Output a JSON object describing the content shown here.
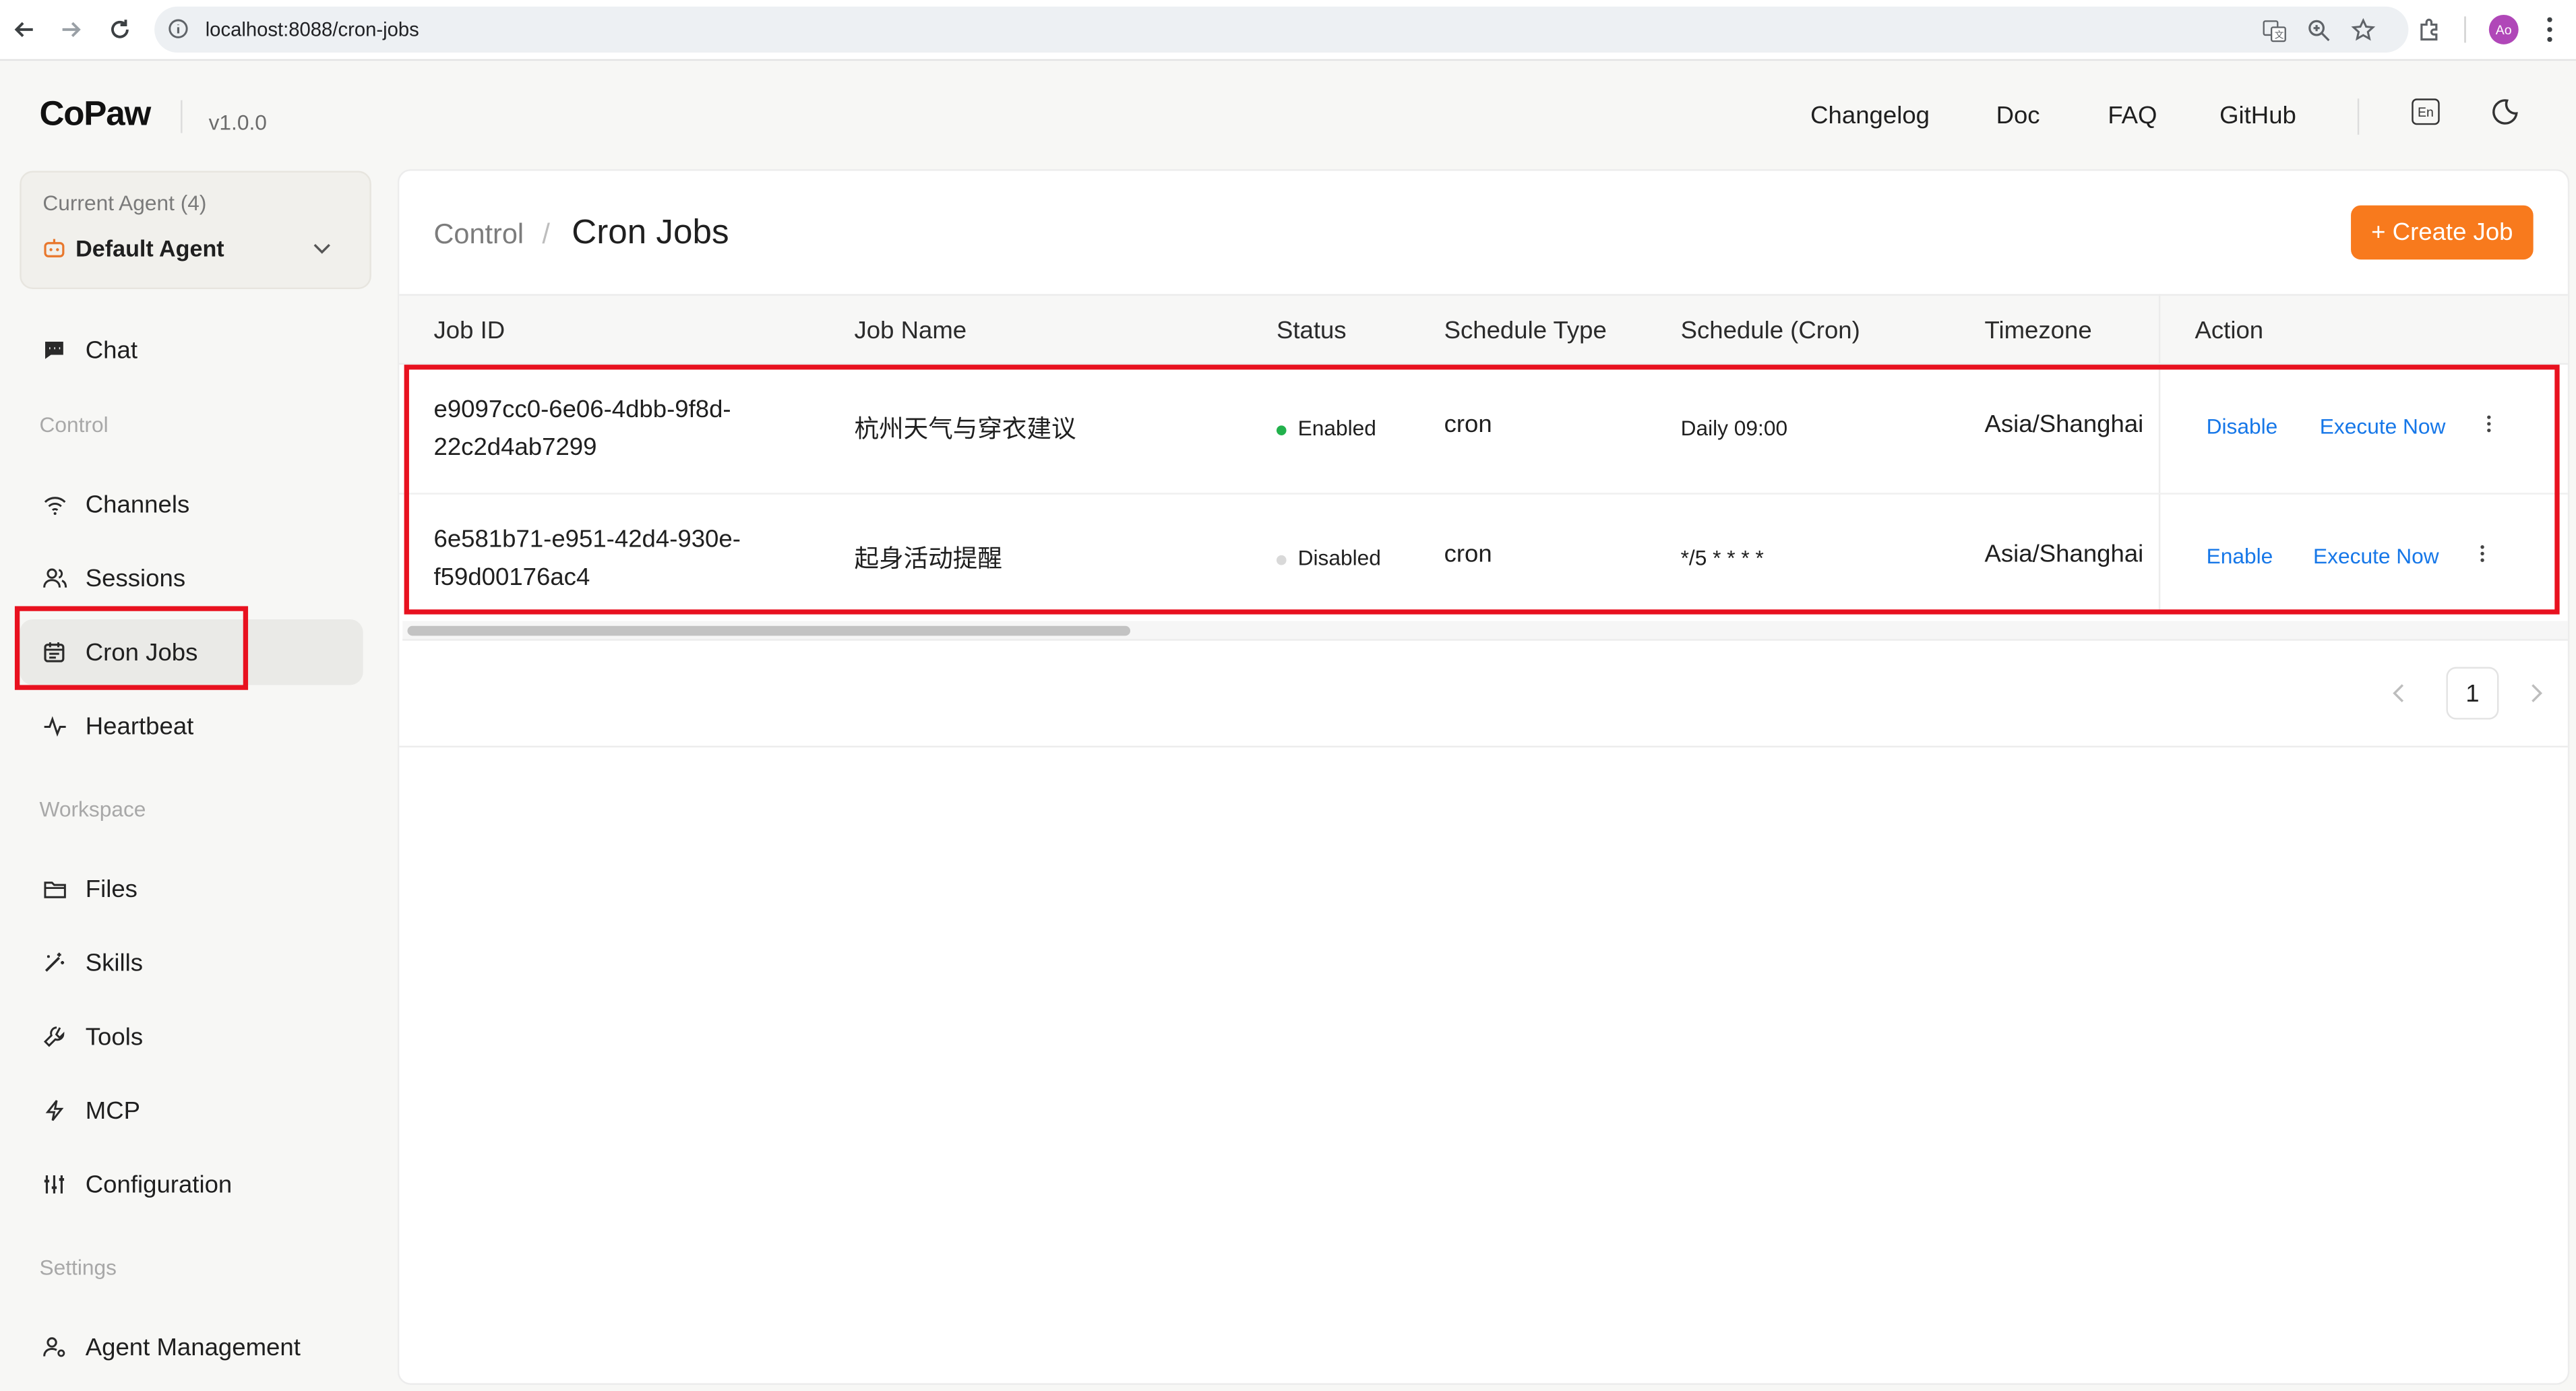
{
  "browser": {
    "url": "localhost:8088/cron-jobs",
    "profile_initials": "Ao"
  },
  "app": {
    "logo": "CoPaw",
    "version": "v1.0.0",
    "nav": [
      "Changelog",
      "Doc",
      "FAQ",
      "GitHub"
    ],
    "lang": "En"
  },
  "sidebar": {
    "agent_caption": "Current Agent (4)",
    "agent_name": "Default Agent",
    "chat": "Chat",
    "section_control": "Control",
    "channels": "Channels",
    "sessions": "Sessions",
    "cron_jobs": "Cron Jobs",
    "heartbeat": "Heartbeat",
    "section_workspace": "Workspace",
    "files": "Files",
    "skills": "Skills",
    "tools": "Tools",
    "mcp": "MCP",
    "configuration": "Configuration",
    "section_settings": "Settings",
    "agent_management": "Agent Management"
  },
  "page": {
    "breadcrumb_parent": "Control",
    "breadcrumb_sep": "/",
    "title": "Cron Jobs",
    "create_button": "+ Create Job"
  },
  "table": {
    "headers": [
      "Job ID",
      "Job Name",
      "Status",
      "Schedule Type",
      "Schedule (Cron)",
      "Timezone",
      "Action"
    ],
    "rows": [
      {
        "id_line1": "e9097cc0-6e06-4dbb-9f8d-",
        "id_line2": "22c2d4ab7299",
        "name": "杭州天气与穿衣建议",
        "status": "Enabled",
        "status_color": "#22b14c",
        "schedule_type": "cron",
        "cron": "Daily 09:00",
        "timezone": "Asia/Shanghai",
        "toggle_action": "Disable",
        "execute_action": "Execute Now"
      },
      {
        "id_line1": "6e581b71-e951-42d4-930e-",
        "id_line2": "f59d00176ac4",
        "name": "起身活动提醒",
        "status": "Disabled",
        "status_color": "#d9d9d9",
        "schedule_type": "cron",
        "cron": "*/5 * * * *",
        "timezone": "Asia/Shanghai",
        "toggle_action": "Enable",
        "execute_action": "Execute Now"
      }
    ]
  },
  "pagination": {
    "current_page": "1"
  },
  "colors": {
    "accent": "#f87a1d",
    "link": "#1677e8",
    "highlight": "#e8111f"
  }
}
